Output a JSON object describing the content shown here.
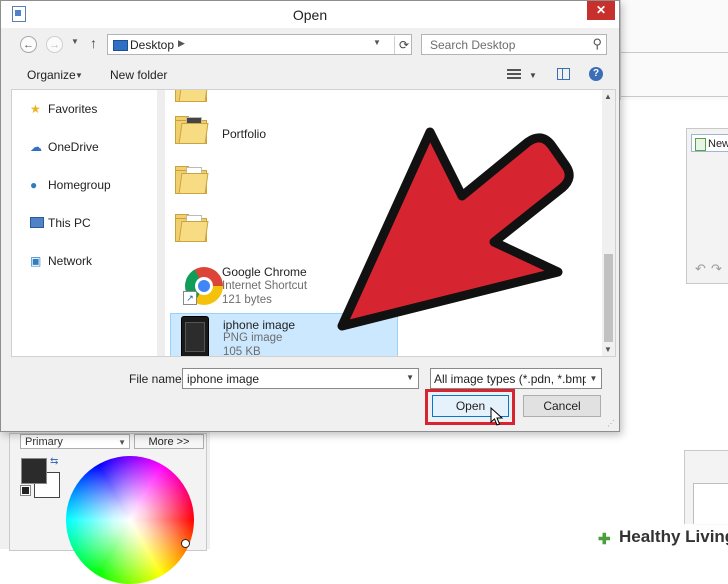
{
  "dialog": {
    "title": "Open",
    "close_glyph": "✕",
    "address": {
      "location": "Desktop"
    },
    "search": {
      "placeholder": "Search Desktop"
    },
    "toolbar": {
      "organize_label": "Organize",
      "new_folder_label": "New folder",
      "help_glyph": "?"
    },
    "navigation": [
      {
        "label": "Favorites",
        "icon": "star-icon"
      },
      {
        "label": "OneDrive",
        "icon": "cloud-icon"
      },
      {
        "label": "Homegroup",
        "icon": "homegroup-icon"
      },
      {
        "label": "This PC",
        "icon": "computer-icon"
      },
      {
        "label": "Network",
        "icon": "network-icon"
      }
    ],
    "files": [
      {
        "name": "Portfolio",
        "type": "folder"
      },
      {
        "name": "",
        "type": "folder"
      },
      {
        "name": "",
        "type": "folder"
      },
      {
        "name": "Google Chrome",
        "kind": "Internet Shortcut",
        "size": "121 bytes"
      },
      {
        "name": "iphone image",
        "kind": "PNG image",
        "size": "105 KB",
        "selected": true
      }
    ],
    "filename": {
      "label": "File name:",
      "value": "iphone image"
    },
    "filetype": {
      "value": "All image types (*.pdn, *.bmp, *"
    },
    "open_label": "Open",
    "cancel_label": "Cancel"
  },
  "background_app": {
    "new_button_label": "New",
    "primary_label": "Primary",
    "more_label": "More >>"
  },
  "annotation": {
    "arrow_color": "#d62430",
    "highlight_color": "#d62430"
  },
  "watermark": {
    "text": "Healthy Living"
  },
  "colors": {
    "accent": "#0078d7",
    "selected_row": "#cce8ff",
    "close_button": "#c7302c"
  }
}
